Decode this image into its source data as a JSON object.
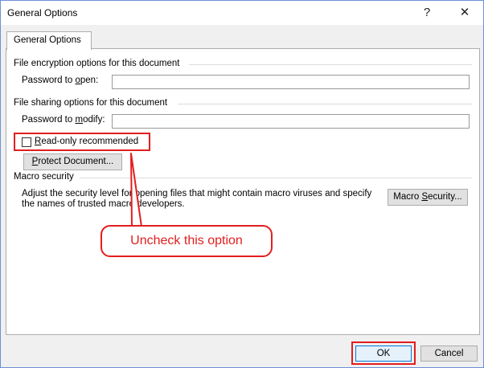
{
  "window": {
    "title": "General Options",
    "help_glyph": "?",
    "close_glyph": "✕"
  },
  "tabs": [
    {
      "label": "General Options"
    }
  ],
  "encryption": {
    "section_title": "File encryption options for this document",
    "password_open_label": "Password to open:",
    "password_open_value": ""
  },
  "sharing": {
    "section_title": "File sharing options for this document",
    "password_modify_label": "Password to modify:",
    "password_modify_value": "",
    "readonly_label": "Read-only recommended",
    "readonly_checked": false,
    "protect_button": "Protect Document..."
  },
  "macro": {
    "section_title": "Macro security",
    "description_line1": "Adjust the security level for opening files that might contain macro viruses and specify",
    "description_line2": "the names of trusted macro developers.",
    "button": "Macro Security..."
  },
  "annotation": {
    "callout_text": "Uncheck this option",
    "color": "#e21e1e"
  },
  "footer": {
    "ok": "OK",
    "cancel": "Cancel"
  }
}
